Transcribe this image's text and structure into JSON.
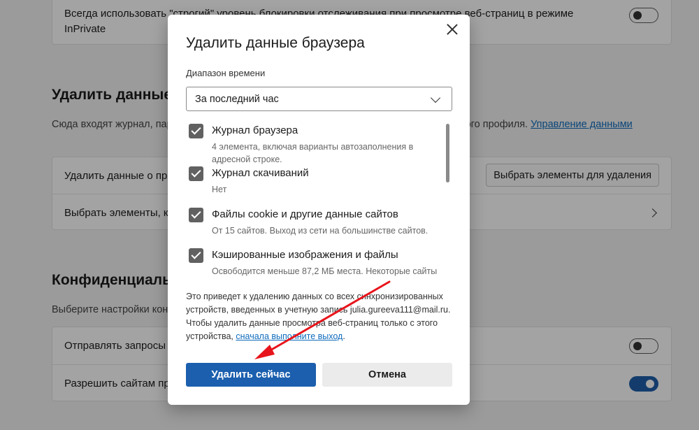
{
  "background": {
    "tracking": {
      "label": "Всегда использовать \"строгий\" уровень блокировки отслеживания при просмотре веб-страниц в режиме InPrivate"
    },
    "clear_section": {
      "title": "Удалить данные просмотра",
      "desc_pre": "Сюда входят журнал, пароли, файлы cookie и прочее. Будут удалены только данные этого профиля.",
      "desc_link": "Управление данными",
      "row_now_label": "Удалить данные о просмотре веб-страниц сейчас",
      "row_now_button": "Выбрать элементы для удаления",
      "row_close_label": "Выбрать элементы, которые будут удаляться при каждом закрытии браузера"
    },
    "privacy_section": {
      "title": "Конфиденциальность",
      "desc": "Выберите настройки конфиденциальности для Microsoft Edge.",
      "row1_label": "Отправлять запросы \"Не отслеживать\"",
      "row2_label": "Разрешить сайтам проверять наличие сохраненных способов оплаты"
    }
  },
  "dialog": {
    "title": "Удалить данные браузера",
    "time_range_label": "Диапазон времени",
    "time_range_value": "За последний час",
    "items": [
      {
        "title": "Журнал браузера",
        "desc": "4 элемента, включая варианты автозаполнения в адресной строке.",
        "checked": true
      },
      {
        "title": "Журнал скачиваний",
        "desc": "Нет",
        "checked": true
      },
      {
        "title": "Файлы cookie и другие данные сайтов",
        "desc": "От 15 сайтов. Выход из сети на большинстве сайтов.",
        "checked": true
      },
      {
        "title": "Кэшированные изображения и файлы",
        "desc": "Освободится меньше 87,2 МБ места. Некоторые сайты",
        "checked": true
      }
    ],
    "note_text": "Это приведет к удалению данных со всех синхронизированных устройств, введенных в учетную запись julia.gureeva111@mail.ru. Чтобы удалить данные просмотра веб-страниц только с этого устройства,",
    "note_link": "сначала выполните выход",
    "note_end": ".",
    "primary_button": "Удалить сейчас",
    "secondary_button": "Отмена"
  },
  "colors": {
    "accent": "#1b5fae",
    "annotation_arrow": "#e8141b"
  }
}
